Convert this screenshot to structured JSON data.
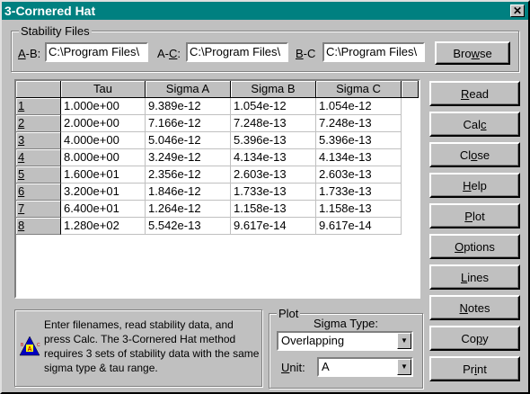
{
  "window": {
    "title": "3-Cornered Hat",
    "close_glyph": "✕"
  },
  "stability_files": {
    "legend": "Stability Files",
    "ab_label_key": "A",
    "ab_label_rest": "-B:",
    "ab_value": "C:\\Program Files\\",
    "ac_label_pre": "A-",
    "ac_label_key": "C",
    "ac_label_rest": ":",
    "ac_value": "C:\\Program Files\\",
    "bc_label_key": "B",
    "bc_label_rest": "-C",
    "bc_value": "C:\\Program Files\\",
    "browse_pre": "Bro",
    "browse_key": "w",
    "browse_post": "se"
  },
  "table": {
    "columns": [
      "Tau",
      "Sigma A",
      "Sigma B",
      "Sigma C"
    ],
    "rows": [
      {
        "n": "1",
        "tau": "1.000e+00",
        "a": "9.389e-12",
        "b": "1.054e-12",
        "c": "1.054e-12"
      },
      {
        "n": "2",
        "tau": "2.000e+00",
        "a": "7.166e-12",
        "b": "7.248e-13",
        "c": "7.248e-13"
      },
      {
        "n": "3",
        "tau": "4.000e+00",
        "a": "5.046e-12",
        "b": "5.396e-13",
        "c": "5.396e-13"
      },
      {
        "n": "4",
        "tau": "8.000e+00",
        "a": "3.249e-12",
        "b": "4.134e-13",
        "c": "4.134e-13"
      },
      {
        "n": "5",
        "tau": "1.600e+01",
        "a": "2.356e-12",
        "b": "2.603e-13",
        "c": "2.603e-13"
      },
      {
        "n": "6",
        "tau": "3.200e+01",
        "a": "1.846e-12",
        "b": "1.733e-13",
        "c": "1.733e-13"
      },
      {
        "n": "7",
        "tau": "6.400e+01",
        "a": "1.264e-12",
        "b": "1.158e-13",
        "c": "1.158e-13"
      },
      {
        "n": "8",
        "tau": "1.280e+02",
        "a": "5.542e-13",
        "b": "9.617e-14",
        "c": "9.617e-14"
      }
    ]
  },
  "info": {
    "text": "Enter filenames, read stability data, and press Calc.  The 3-Cornered Hat method requires 3 sets of stability data with the same sigma type & tau range.",
    "icon": "hat-icon",
    "icon_letters": [
      "A",
      "B",
      "C"
    ]
  },
  "plot": {
    "legend": "Plot",
    "sigma_type_pre": "Si",
    "sigma_type_key": "g",
    "sigma_type_post": "ma Type:",
    "sigma_type_value": "Overlapping",
    "unit_key": "U",
    "unit_rest": "nit:",
    "unit_value": "A"
  },
  "buttons": [
    {
      "pre": "",
      "key": "R",
      "post": "ead"
    },
    {
      "pre": "Cal",
      "key": "c",
      "post": ""
    },
    {
      "pre": "Cl",
      "key": "o",
      "post": "se"
    },
    {
      "pre": "",
      "key": "H",
      "post": "elp"
    },
    {
      "pre": "",
      "key": "P",
      "post": "lot"
    },
    {
      "pre": "",
      "key": "O",
      "post": "ptions"
    },
    {
      "pre": "",
      "key": "L",
      "post": "ines"
    },
    {
      "pre": "",
      "key": "N",
      "post": "otes"
    },
    {
      "pre": "Co",
      "key": "p",
      "post": "y"
    },
    {
      "pre": "Pr",
      "key": "i",
      "post": "nt"
    }
  ]
}
